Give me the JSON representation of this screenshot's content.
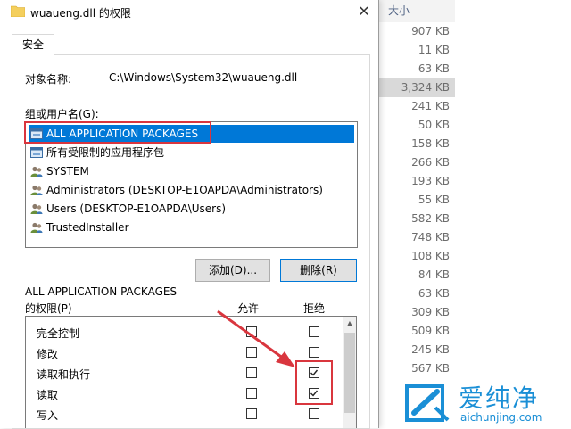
{
  "explorer": {
    "size_header": "大小",
    "sizes": [
      "907 KB",
      "11 KB",
      "63 KB",
      "3,324 KB",
      "241 KB",
      "50 KB",
      "158 KB",
      "266 KB",
      "193 KB",
      "55 KB",
      "582 KB",
      "748 KB",
      "108 KB",
      "84 KB",
      "63 KB",
      "309 KB",
      "509 KB",
      "245 KB",
      "567 KB"
    ],
    "selected_index": 3
  },
  "dialog": {
    "title": "wuaueng.dll 的权限",
    "close_glyph": "✕",
    "tab": "安全",
    "object_label": "对象名称:",
    "object_value": "C:\\Windows\\System32\\wuaueng.dll",
    "group_label": "组或用户名(G):",
    "users": [
      {
        "label": "ALL APPLICATION PACKAGES",
        "icon": "app-packages-icon",
        "selected": true
      },
      {
        "label": "所有受限制的应用程序包",
        "icon": "app-packages-icon",
        "selected": false
      },
      {
        "label": "SYSTEM",
        "icon": "users-icon",
        "selected": false
      },
      {
        "label": "Administrators (DESKTOP-E1OAPDA\\Administrators)",
        "icon": "users-icon",
        "selected": false
      },
      {
        "label": "Users (DESKTOP-E1OAPDA\\Users)",
        "icon": "users-icon",
        "selected": false
      },
      {
        "label": "TrustedInstaller",
        "icon": "users-icon",
        "selected": false
      }
    ],
    "add_button": "添加(D)...",
    "remove_button": "删除(R)",
    "perm_title_line1": "ALL APPLICATION PACKAGES",
    "perm_title_line2": "的权限(P)",
    "allow_header": "允许",
    "deny_header": "拒绝",
    "permissions": [
      {
        "name": "完全控制",
        "allow": false,
        "deny": false
      },
      {
        "name": "修改",
        "allow": false,
        "deny": false
      },
      {
        "name": "读取和执行",
        "allow": false,
        "deny": true
      },
      {
        "name": "读取",
        "allow": false,
        "deny": true
      },
      {
        "name": "写入",
        "allow": false,
        "deny": false
      }
    ]
  },
  "watermark": {
    "cn": "爱纯净",
    "en": "aichunjing.com",
    "color": "#1a8fd6"
  },
  "colors": {
    "selection": "#0078d7",
    "annotation_red": "#d9363e"
  }
}
